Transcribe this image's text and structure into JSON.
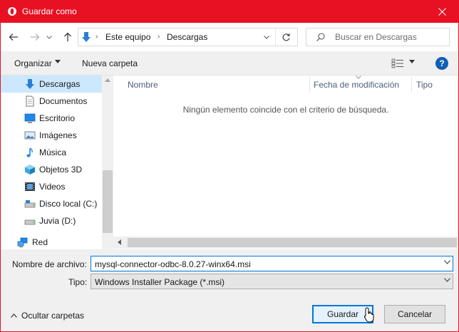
{
  "window": {
    "title": "Guardar como",
    "accent_color": "#e81123"
  },
  "nav": {
    "back_icon": "arrow-left-icon",
    "forward_icon": "arrow-right-icon",
    "recent_icon": "chevron-down-icon",
    "up_icon": "arrow-up-icon",
    "breadcrumb": [
      "Este equipo",
      "Descargas"
    ],
    "refresh_icon": "refresh-icon",
    "search_placeholder": "Buscar en Descargas"
  },
  "toolbar": {
    "organize_label": "Organizar",
    "new_folder_label": "Nueva carpeta",
    "help_label": "?"
  },
  "sidebar": {
    "items": [
      {
        "label": "Descargas",
        "icon": "download-arrow-icon",
        "selected": true
      },
      {
        "label": "Documentos",
        "icon": "document-icon"
      },
      {
        "label": "Escritorio",
        "icon": "desktop-icon"
      },
      {
        "label": "Imágenes",
        "icon": "pictures-icon"
      },
      {
        "label": "Música",
        "icon": "music-note-icon"
      },
      {
        "label": "Objetos 3D",
        "icon": "cube-3d-icon"
      },
      {
        "label": "Videos",
        "icon": "film-icon"
      },
      {
        "label": "Disco local (C:)",
        "icon": "drive-icon"
      },
      {
        "label": "Juvia (D:)",
        "icon": "drive-icon"
      },
      {
        "label": "Red",
        "icon": "network-icon"
      }
    ]
  },
  "content": {
    "columns": [
      "Nombre",
      "Fecha de modificación",
      "Tipo"
    ],
    "empty_message": "Ningún elemento coincide con el criterio de búsqueda."
  },
  "bottom": {
    "filename_label": "Nombre de archivo:",
    "filename_value": "mysql-connector-odbc-8.0.27-winx64.msi",
    "type_label": "Tipo:",
    "type_value": "Windows Installer Package (*.msi)",
    "hide_folders_label": "Ocultar carpetas",
    "save_label": "Guardar",
    "cancel_label": "Cancelar"
  }
}
